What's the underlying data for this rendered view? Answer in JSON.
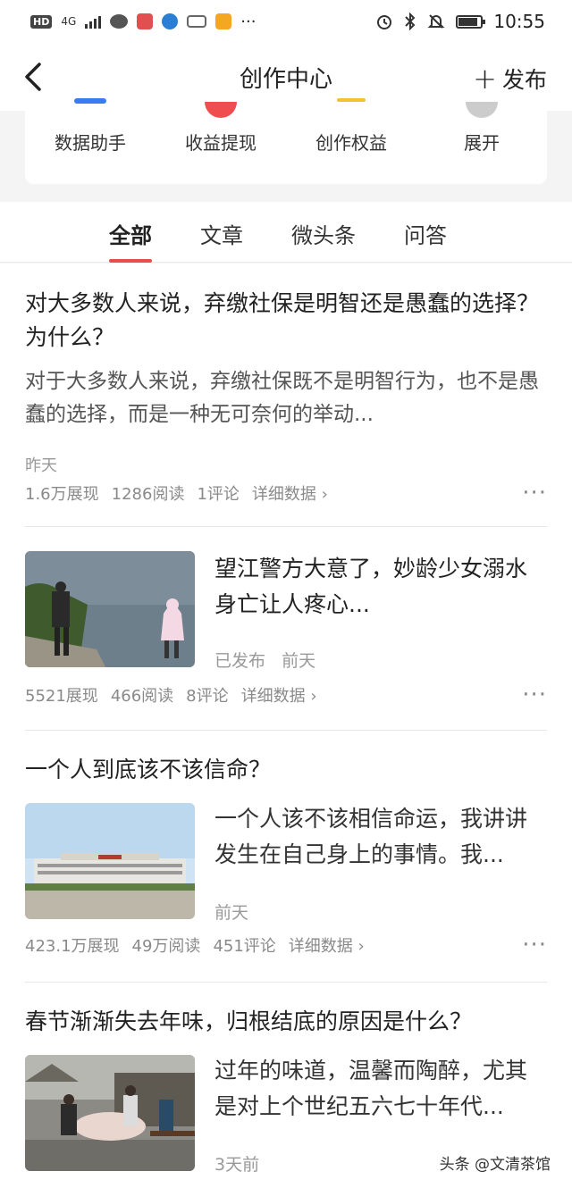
{
  "status_bar": {
    "network": "HD",
    "signal": "4G",
    "time": "10:55"
  },
  "nav": {
    "title": "创作中心",
    "publish_label": "发布"
  },
  "tools": [
    {
      "label": "数据助手",
      "color": "#3a7cf0"
    },
    {
      "label": "收益提现",
      "color": "#f04e4e"
    },
    {
      "label": "创作权益",
      "color": "#f2c230"
    },
    {
      "label": "展开",
      "color": "#cccccc"
    }
  ],
  "tabs": [
    {
      "label": "全部",
      "active": true
    },
    {
      "label": "文章",
      "active": false
    },
    {
      "label": "微头条",
      "active": false
    },
    {
      "label": "问答",
      "active": false
    }
  ],
  "feed": {
    "items": [
      {
        "title": "对大多数人来说，弃缴社保是明智还是愚蠢的选择？为什么？",
        "abstract": "对于大多数人来说，弃缴社保既不是明智行为，也不是愚蠢的选择，而是一种无可奈何的举动...",
        "time": "昨天",
        "impressions": "1.6万展现",
        "reads": "1286阅读",
        "comments": "1评论",
        "detail": "详细数据"
      },
      {
        "title": "望江警方大意了，妙龄少女溺水身亡让人疼心...",
        "status": "已发布",
        "time": "前天",
        "impressions": "5521展现",
        "reads": "466阅读",
        "comments": "8评论",
        "detail": "详细数据"
      },
      {
        "title": "一个人到底该不该信命？",
        "abstract": "一个人该不该相信命运，我讲讲发生在自己身上的事情。我...",
        "time": "前天",
        "impressions": "423.1万展现",
        "reads": "49万阅读",
        "comments": "451评论",
        "detail": "详细数据"
      },
      {
        "title": "春节渐渐失去年味，归根结底的原因是什么？",
        "abstract": "过年的味道，温馨而陶醉，尤其是对上个世纪五六七十年代...",
        "time": "3天前"
      }
    ]
  },
  "watermark": "头条 @文清茶馆"
}
